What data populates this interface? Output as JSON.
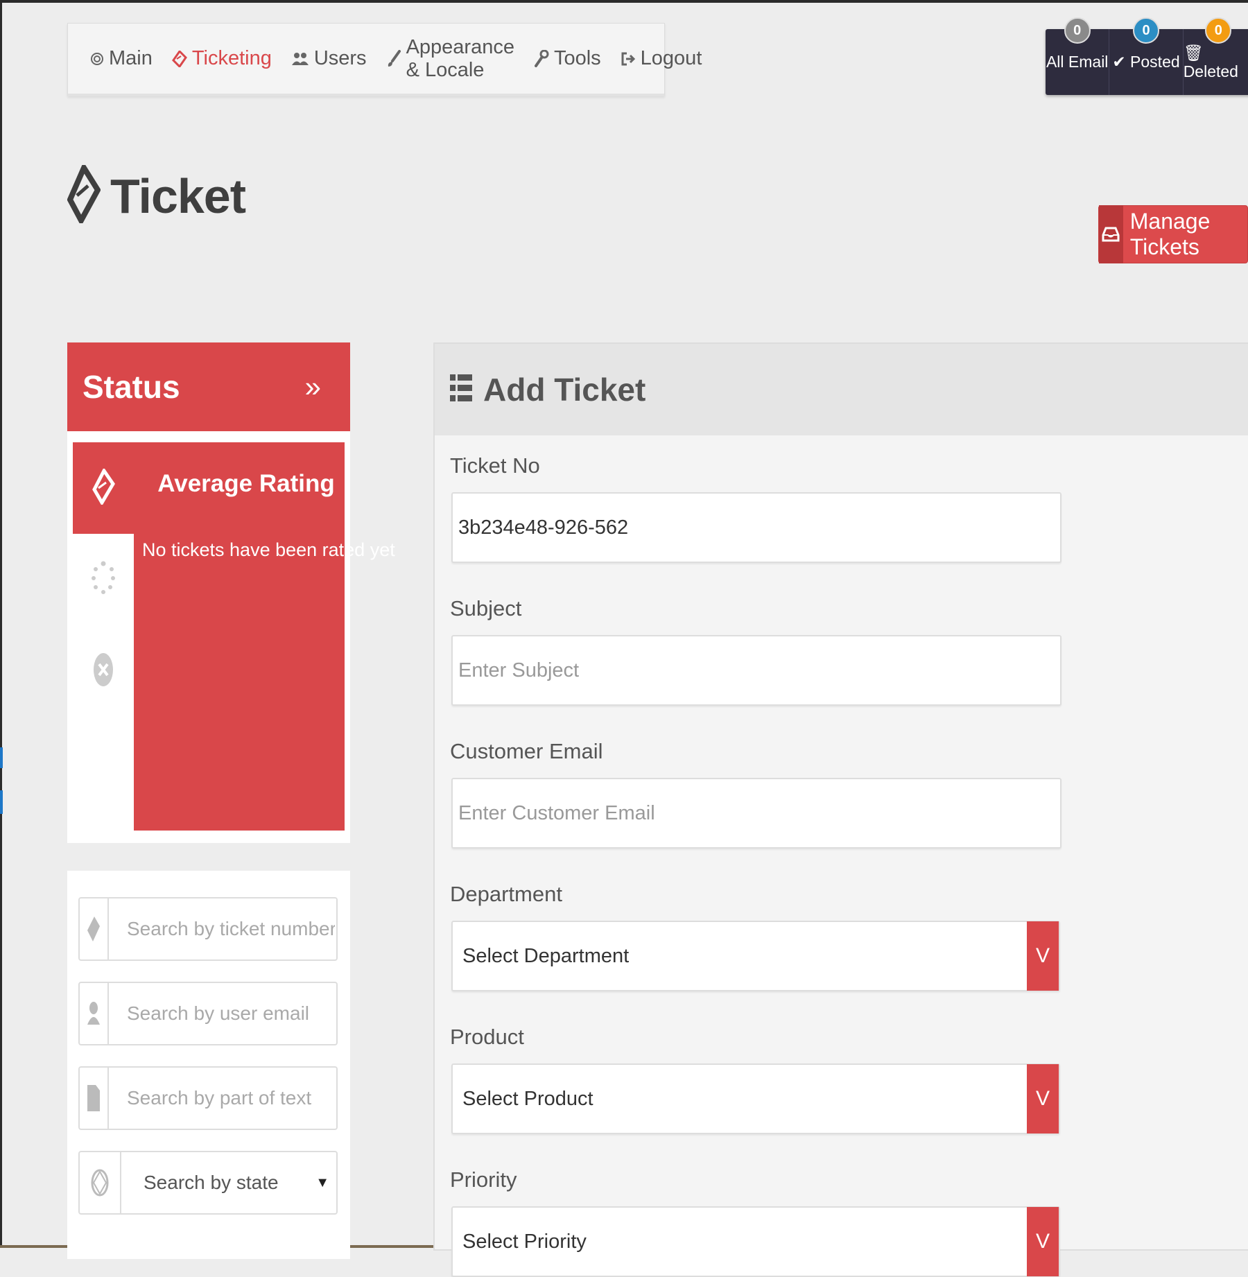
{
  "nav": {
    "items": [
      {
        "label": "Main",
        "icon": "dashboard-icon",
        "active": false
      },
      {
        "label": "Ticketing",
        "icon": "ticket-icon",
        "active": true
      },
      {
        "label": "Users",
        "icon": "users-icon",
        "active": false
      },
      {
        "label": "Appearance & Locale",
        "icon": "brush-icon",
        "active": false
      },
      {
        "label": "Tools",
        "icon": "wrench-icon",
        "active": false
      },
      {
        "label": "Logout",
        "icon": "logout-icon",
        "active": false
      }
    ]
  },
  "counters": [
    {
      "label": "All Email",
      "count": "0",
      "badge_color": "#8a8a8a"
    },
    {
      "label": "✔ Posted",
      "count": "0",
      "badge_color": "#2c8ec4"
    },
    {
      "label": "🗑 Deleted",
      "count": "0",
      "badge_color": "#f39c12"
    }
  ],
  "page": {
    "title": "Ticket",
    "manage_button": "Manage Tickets"
  },
  "status": {
    "title": "Status",
    "average_rating_title": "Average Rating",
    "no_ratings_text": "No tickets have been rated yet"
  },
  "search": {
    "ticket_number_placeholder": "Search by ticket number",
    "user_email_placeholder": "Search by user email",
    "text_placeholder": "Search by part of text",
    "state_label": "Search by state"
  },
  "form": {
    "title": "Add Ticket",
    "ticket_no_label": "Ticket No",
    "ticket_no_value": "3b234e48-926-562",
    "subject_label": "Subject",
    "subject_placeholder": "Enter Subject",
    "email_label": "Customer Email",
    "email_placeholder": "Enter Customer Email",
    "department_label": "Department",
    "department_value": "Select Department",
    "product_label": "Product",
    "product_value": "Select Product",
    "priority_label": "Priority",
    "priority_value": "Select Priority",
    "select_arrow": "V"
  },
  "colors": {
    "accent_red": "#d9474a",
    "dark_bar": "#2e2c3e"
  }
}
